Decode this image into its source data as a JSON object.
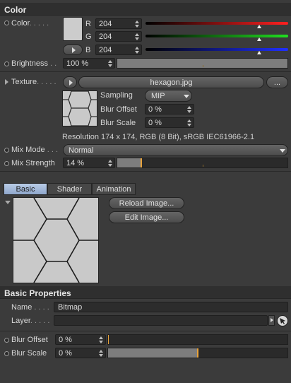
{
  "color_section": {
    "title": "Color",
    "color_label": "Color",
    "color_dots": ". . . . .",
    "swatch_color": "#cccccc",
    "channels": [
      {
        "key": "R",
        "value": "204",
        "gradient": "linear-gradient(90deg,#000000,#ff2020)"
      },
      {
        "key": "G",
        "value": "204",
        "gradient": "linear-gradient(90deg,#000000,#20e020)"
      },
      {
        "key": "B",
        "value": "204",
        "gradient": "linear-gradient(90deg,#000000,#2030ff)"
      }
    ],
    "brightness_label": "Brightness",
    "brightness_dots": ". .",
    "brightness_value": "100 %",
    "brightness_level": 1.0
  },
  "texture": {
    "label": "Texture",
    "dots": ". . . . .",
    "filename": "hexagon.jpg",
    "more_button": "...",
    "sampling_label": "Sampling",
    "sampling_value": "MIP",
    "blur_offset_label": "Blur Offset",
    "blur_offset_value": "0 %",
    "blur_scale_label": "Blur Scale",
    "blur_scale_value": "0 %",
    "resolution_text": "Resolution 174 x 174, RGB (8 Bit), sRGB IEC61966-2.1"
  },
  "mix": {
    "mode_label": "Mix Mode",
    "mode_dots": ". . .",
    "mode_value": "Normal",
    "strength_label": "Mix Strength",
    "strength_value": "14 %",
    "strength_level": 0.14
  },
  "tabs": [
    {
      "label": "Basic"
    },
    {
      "label": "Shader"
    },
    {
      "label": "Animation"
    }
  ],
  "preview": {
    "reload_button": "Reload Image...",
    "edit_button": "Edit Image..."
  },
  "basic_properties": {
    "title": "Basic Properties",
    "name_label": "Name",
    "name_dots": ". . . .",
    "name_value": "Bitmap",
    "layer_label": "Layer",
    "layer_dots": ". . . . .",
    "layer_value": "",
    "blur_offset_label": "Blur Offset",
    "blur_offset_value": "0 %",
    "blur_offset_level": 0.0,
    "blur_scale_label": "Blur Scale",
    "blur_scale_value": "0 %",
    "blur_scale_level": 0.5
  }
}
